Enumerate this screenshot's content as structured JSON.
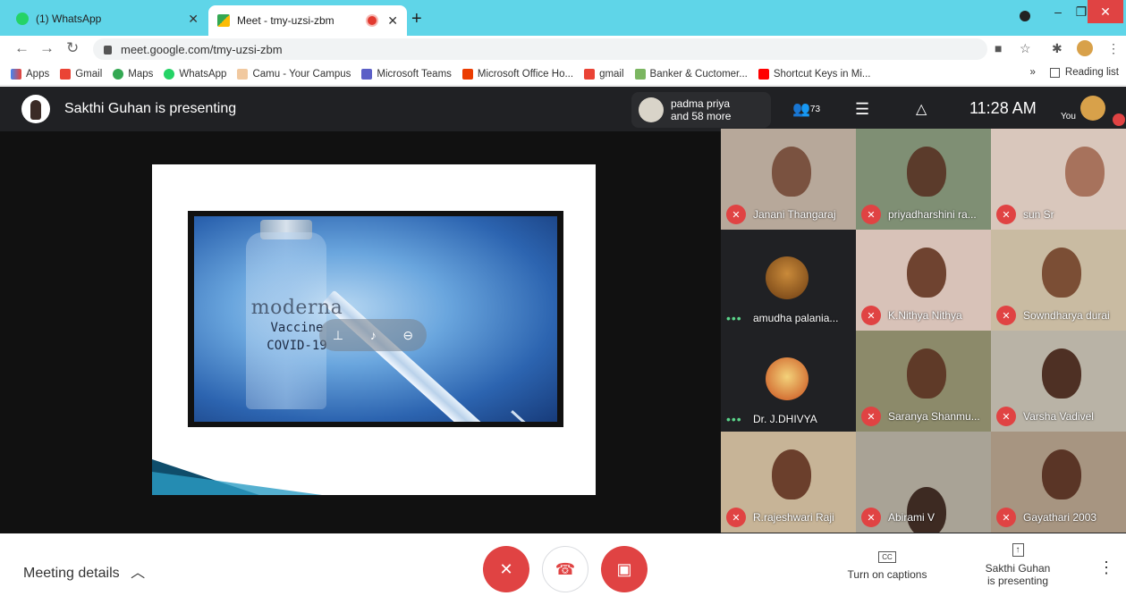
{
  "browser": {
    "tabs": [
      {
        "title": "(1) WhatsApp",
        "active": false
      },
      {
        "title": "Meet - tmy-uzsi-zbm",
        "active": true
      }
    ],
    "url": "meet.google.com/tmy-uzsi-zbm",
    "bookmarks": [
      "Apps",
      "Gmail",
      "Maps",
      "WhatsApp",
      "Camu - Your Campus",
      "Microsoft Teams",
      "Microsoft Office Ho...",
      "gmail",
      "Banker & Cuctomer...",
      "Shortcut Keys in Mi..."
    ],
    "overflow": "»",
    "reading_list": "Reading list"
  },
  "meet": {
    "presenter_text": "Sakthi Guhan is presenting",
    "top_pill": {
      "name": "padma priya",
      "more": "and 58 more"
    },
    "participant_count": "73",
    "clock": "11:28 AM",
    "you_label": "You",
    "slide": {
      "brand": "moderna",
      "line1": "Vaccine",
      "line2": "COVID-19"
    },
    "participants": [
      {
        "name": "Janani Thangaraj",
        "status": "muted"
      },
      {
        "name": "priyadharshini ra...",
        "status": "muted"
      },
      {
        "name": "sun Sr",
        "status": "muted"
      },
      {
        "name": "amudha palania...",
        "status": "speaking"
      },
      {
        "name": "K.Nithya Nithya",
        "status": "muted"
      },
      {
        "name": "Sowndharya durai",
        "status": "muted"
      },
      {
        "name": "Dr. J.DHIVYA",
        "status": "speaking"
      },
      {
        "name": "Saranya Shanmu...",
        "status": "muted"
      },
      {
        "name": "Varsha Vadivel",
        "status": "muted"
      },
      {
        "name": "R.rajeshwari Raji",
        "status": "muted"
      },
      {
        "name": "Abirami V",
        "status": "muted"
      },
      {
        "name": "Gayathari 2003",
        "status": "muted"
      }
    ]
  },
  "bottom": {
    "meeting_details": "Meeting details",
    "captions": "Turn on captions",
    "captions_icon": "CC",
    "presenting_line1": "Sakthi Guhan",
    "presenting_line2": "is presenting"
  },
  "colors": {
    "tabstrip": "#5fd5e8",
    "meet_bg": "#202124",
    "danger": "#e04343"
  }
}
